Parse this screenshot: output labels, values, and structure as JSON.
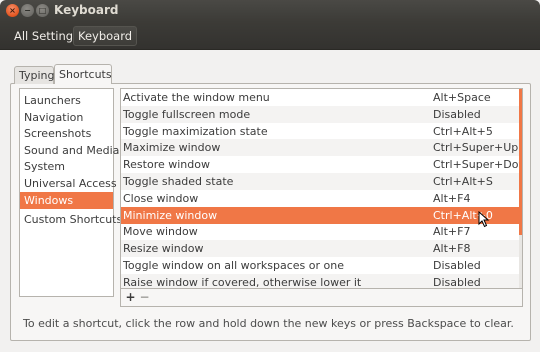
{
  "window": {
    "title": "Keyboard"
  },
  "breadcrumb": [
    "All Settings",
    "Keyboard"
  ],
  "tabs": [
    {
      "label": "Typing",
      "selected": false
    },
    {
      "label": "Shortcuts",
      "selected": true
    }
  ],
  "categories": [
    {
      "label": "Launchers",
      "selected": false
    },
    {
      "label": "Navigation",
      "selected": false
    },
    {
      "label": "Screenshots",
      "selected": false
    },
    {
      "label": "Sound and Media",
      "selected": false
    },
    {
      "label": "System",
      "selected": false
    },
    {
      "label": "Universal Access",
      "selected": false
    },
    {
      "label": "Windows",
      "selected": true
    },
    {
      "label": "Custom Shortcuts",
      "selected": false
    }
  ],
  "shortcuts": [
    {
      "name": "Activate the window menu",
      "accel": "Alt+Space"
    },
    {
      "name": "Toggle fullscreen mode",
      "accel": "Disabled"
    },
    {
      "name": "Toggle maximization state",
      "accel": "Ctrl+Alt+5"
    },
    {
      "name": "Maximize window",
      "accel": "Ctrl+Super+Up"
    },
    {
      "name": "Restore window",
      "accel": "Ctrl+Super+Down"
    },
    {
      "name": "Toggle shaded state",
      "accel": "Ctrl+Alt+S"
    },
    {
      "name": "Close window",
      "accel": "Alt+F4"
    },
    {
      "name": "Minimize window",
      "accel": "Ctrl+Alt+0",
      "selected": true
    },
    {
      "name": "Move window",
      "accel": "Alt+F7"
    },
    {
      "name": "Resize window",
      "accel": "Alt+F8"
    },
    {
      "name": "Toggle window on all workspaces or one",
      "accel": "Disabled"
    },
    {
      "name": "Raise window if covered, otherwise lower it",
      "accel": "Disabled"
    }
  ],
  "buttons": {
    "add": "+",
    "remove": "−"
  },
  "hint": "To edit a shortcut, click the row and hold down the new keys or press Backspace to clear.",
  "colors": {
    "accent": "#f07746",
    "titlebar": "#3c3b37"
  },
  "icons": {
    "close": "close-icon",
    "minimize": "minimize-icon",
    "maximize": "maximize-icon",
    "cursor": "mouse-pointer-icon"
  }
}
